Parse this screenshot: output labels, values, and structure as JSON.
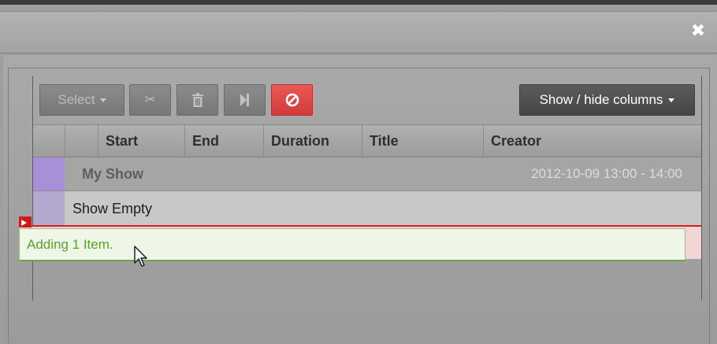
{
  "dialog": {
    "close_glyph": "✖"
  },
  "toolbar": {
    "select_label": "Select",
    "cut_icon": "✂",
    "delete_icon": "🗑",
    "skip_icon": "⏭",
    "cancel_icon": "⊘",
    "show_hide_columns_label": "Show / hide columns",
    "cancel_color": "#d9423f"
  },
  "table": {
    "columns": [
      "",
      "",
      "Start",
      "End",
      "Duration",
      "Title",
      "Creator"
    ],
    "show_header": {
      "name": "My Show",
      "time_range": "2012-10-09 13:00 - 14:00",
      "color": "#a98fd8"
    },
    "empty_row_label": "Show Empty"
  },
  "drag": {
    "helper_text": "Adding 1 Item."
  }
}
